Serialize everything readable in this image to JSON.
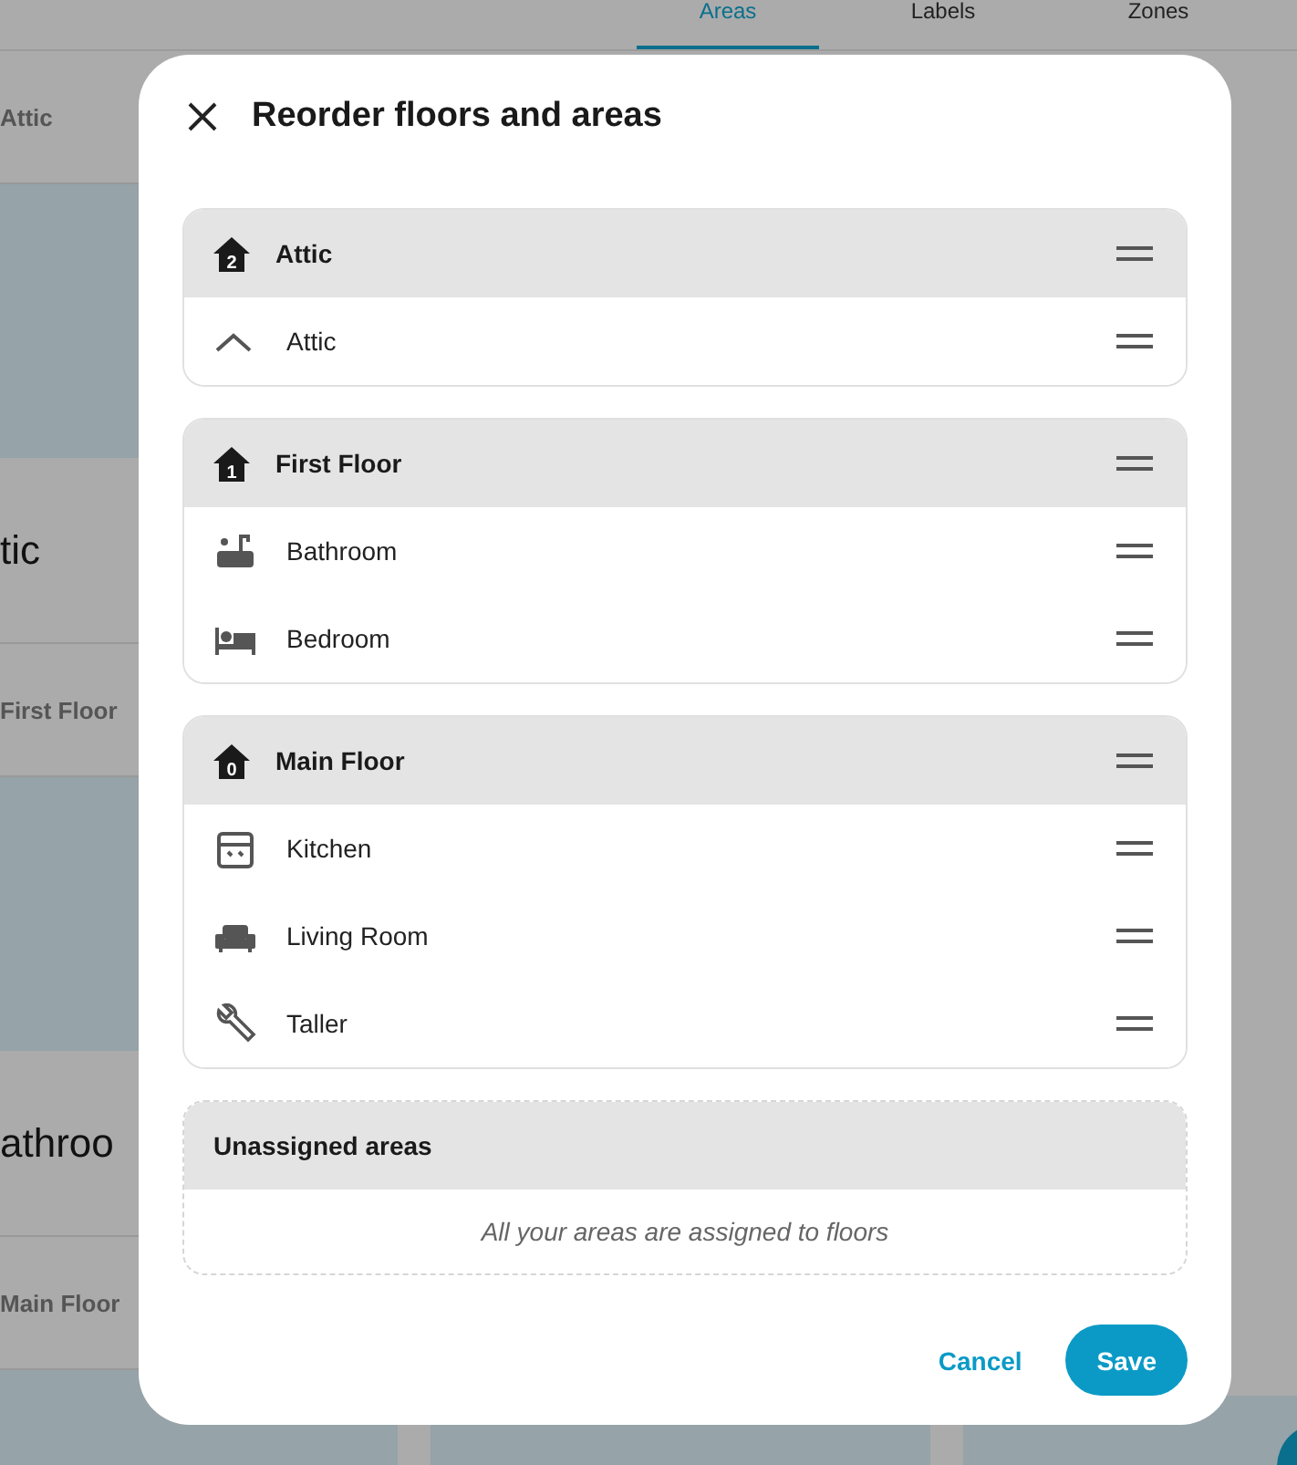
{
  "background": {
    "tabs": [
      {
        "label": "Areas",
        "selected": true
      },
      {
        "label": "Labels",
        "selected": false
      },
      {
        "label": "Zones",
        "selected": false
      }
    ],
    "column": [
      {
        "kind": "floor",
        "text": "Attic"
      },
      {
        "kind": "picture"
      },
      {
        "kind": "name",
        "text": "tic"
      },
      {
        "kind": "floor",
        "text": "First Floor"
      },
      {
        "kind": "picture"
      },
      {
        "kind": "name",
        "text": "athroo"
      },
      {
        "kind": "floor",
        "text": "Main Floor"
      },
      {
        "kind": "picture"
      }
    ]
  },
  "dialog": {
    "title": "Reorder floors and areas",
    "floors": [
      {
        "name": "Attic",
        "level_mark": "2",
        "areas": [
          {
            "name": "Attic"
          }
        ]
      },
      {
        "name": "First Floor",
        "level_mark": "1",
        "areas": [
          {
            "name": "Bathroom"
          },
          {
            "name": "Bedroom"
          }
        ]
      },
      {
        "name": "Main Floor",
        "level_mark": "0",
        "areas": [
          {
            "name": "Kitchen"
          },
          {
            "name": "Living Room"
          },
          {
            "name": "Taller"
          }
        ]
      }
    ],
    "unassigned": {
      "title": "Unassigned areas",
      "message": "All your areas are assigned to floors"
    },
    "buttons": [
      {
        "kind": "text",
        "label": "Cancel"
      },
      {
        "kind": "filled",
        "label": "Save"
      }
    ]
  }
}
